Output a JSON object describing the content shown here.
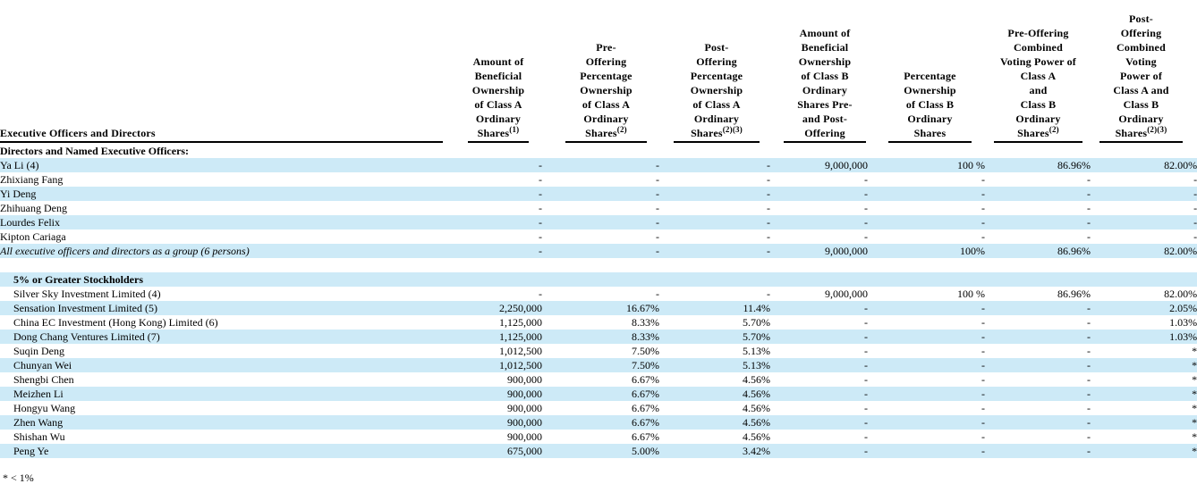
{
  "headers": [
    {
      "lines": [
        "Executive Officers and Directors"
      ],
      "sup": ""
    },
    {
      "lines": [
        "Amount of",
        "Beneficial",
        "Ownership",
        "of Class A",
        "Ordinary",
        "Shares"
      ],
      "sup": "(1)"
    },
    {
      "lines": [
        "Pre-",
        "Offering",
        "Percentage",
        "Ownership",
        "of Class A",
        "Ordinary",
        "Shares"
      ],
      "sup": "(2)"
    },
    {
      "lines": [
        "Post-",
        "Offering",
        "Percentage",
        "Ownership",
        "of Class A",
        "Ordinary",
        "Shares"
      ],
      "sup": "(2)(3)"
    },
    {
      "lines": [
        "Amount of",
        "Beneficial",
        "Ownership",
        "of Class B",
        "Ordinary",
        "Shares Pre-",
        "and Post-",
        "Offering"
      ],
      "sup": ""
    },
    {
      "lines": [
        "Percentage",
        "Ownership",
        "of Class B",
        "Ordinary",
        "Shares"
      ],
      "sup": ""
    },
    {
      "lines": [
        "Pre-Offering",
        "Combined",
        "Voting Power of",
        "Class A",
        "and",
        "Class B",
        "Ordinary",
        "Shares"
      ],
      "sup": "(2)"
    },
    {
      "lines": [
        "Post-",
        "Offering",
        "Combined",
        "Voting",
        "Power of",
        "Class A and",
        "Class B",
        "Ordinary",
        "Shares"
      ],
      "sup": "(2)(3)"
    }
  ],
  "rows": [
    {
      "type": "section",
      "name": "Directors and Named Executive Officers:",
      "shade": false,
      "indent": false
    },
    {
      "type": "data",
      "name": "Ya Li (4)",
      "shade": true,
      "indent": false,
      "italic": false,
      "cells": [
        "-",
        "-",
        "-",
        "9,000,000",
        "100 %",
        "86.96%",
        "82.00%"
      ]
    },
    {
      "type": "data",
      "name": "Zhixiang Fang",
      "shade": false,
      "indent": false,
      "italic": false,
      "cells": [
        "-",
        "-",
        "-",
        "-",
        "-",
        "-",
        "-"
      ]
    },
    {
      "type": "data",
      "name": "Yi Deng",
      "shade": true,
      "indent": false,
      "italic": false,
      "cells": [
        "-",
        "-",
        "-",
        "-",
        "-",
        "-",
        "-"
      ]
    },
    {
      "type": "data",
      "name": "Zhihuang Deng",
      "shade": false,
      "indent": false,
      "italic": false,
      "cells": [
        "-",
        "-",
        "-",
        "-",
        "-",
        "-",
        "-"
      ]
    },
    {
      "type": "data",
      "name": "Lourdes Felix",
      "shade": true,
      "indent": false,
      "italic": false,
      "cells": [
        "-",
        "-",
        "-",
        "-",
        "-",
        "-",
        "-"
      ]
    },
    {
      "type": "data",
      "name": "Kipton Cariaga",
      "shade": false,
      "indent": false,
      "italic": false,
      "cells": [
        "-",
        "-",
        "-",
        "-",
        "-",
        "-",
        "-"
      ]
    },
    {
      "type": "data",
      "name": "All executive officers and directors as a group (6 persons)",
      "shade": true,
      "indent": false,
      "italic": true,
      "cells": [
        "-",
        "-",
        "-",
        "9,000,000",
        "100%",
        "86.96%",
        "82.00%"
      ]
    },
    {
      "type": "blank",
      "shade": false
    },
    {
      "type": "section",
      "name": "5% or Greater Stockholders",
      "shade": true,
      "indent": true
    },
    {
      "type": "data",
      "name": "Silver Sky Investment Limited (4)",
      "shade": false,
      "indent": true,
      "italic": false,
      "cells": [
        "-",
        "-",
        "-",
        "9,000,000",
        "100 %",
        "86.96%",
        "82.00%"
      ]
    },
    {
      "type": "data",
      "name": "Sensation Investment Limited (5)",
      "shade": true,
      "indent": true,
      "italic": false,
      "cells": [
        "2,250,000",
        "16.67%",
        "11.4%",
        "-",
        "-",
        "-",
        "2.05%"
      ]
    },
    {
      "type": "data",
      "name": "China EC Investment (Hong Kong) Limited (6)",
      "shade": false,
      "indent": true,
      "italic": false,
      "cells": [
        "1,125,000",
        "8.33%",
        "5.70%",
        "-",
        "-",
        "-",
        "1.03%"
      ]
    },
    {
      "type": "data",
      "name": "Dong Chang Ventures Limited (7)",
      "shade": true,
      "indent": true,
      "italic": false,
      "cells": [
        "1,125,000",
        "8.33%",
        "5.70%",
        "-",
        "-",
        "-",
        "1.03%"
      ]
    },
    {
      "type": "data",
      "name": "Suqin Deng",
      "shade": false,
      "indent": true,
      "italic": false,
      "cells": [
        "1,012,500",
        "7.50%",
        "5.13%",
        "-",
        "-",
        "-",
        "*"
      ]
    },
    {
      "type": "data",
      "name": "Chunyan Wei",
      "shade": true,
      "indent": true,
      "italic": false,
      "cells": [
        "1,012,500",
        "7.50%",
        "5.13%",
        "-",
        "-",
        "-",
        "*"
      ]
    },
    {
      "type": "data",
      "name": "Shengbi Chen",
      "shade": false,
      "indent": true,
      "italic": false,
      "cells": [
        "900,000",
        "6.67%",
        "4.56%",
        "-",
        "-",
        "-",
        "*"
      ]
    },
    {
      "type": "data",
      "name": "Meizhen Li",
      "shade": true,
      "indent": true,
      "italic": false,
      "cells": [
        "900,000",
        "6.67%",
        "4.56%",
        "-",
        "-",
        "-",
        "*"
      ]
    },
    {
      "type": "data",
      "name": "Hongyu Wang",
      "shade": false,
      "indent": true,
      "italic": false,
      "cells": [
        "900,000",
        "6.67%",
        "4.56%",
        "-",
        "-",
        "-",
        "*"
      ]
    },
    {
      "type": "data",
      "name": "Zhen Wang",
      "shade": true,
      "indent": true,
      "italic": false,
      "cells": [
        "900,000",
        "6.67%",
        "4.56%",
        "-",
        "-",
        "-",
        "*"
      ]
    },
    {
      "type": "data",
      "name": "Shishan Wu",
      "shade": false,
      "indent": true,
      "italic": false,
      "cells": [
        "900,000",
        "6.67%",
        "4.56%",
        "-",
        "-",
        "-",
        "*"
      ]
    },
    {
      "type": "data",
      "name": "Peng Ye",
      "shade": true,
      "indent": true,
      "italic": false,
      "cells": [
        "675,000",
        "5.00%",
        "3.42%",
        "-",
        "-",
        "-",
        "*"
      ]
    }
  ],
  "footnote": "*    < 1%",
  "colors": {
    "shade": "#cdeaf7",
    "rule": "#000000"
  }
}
